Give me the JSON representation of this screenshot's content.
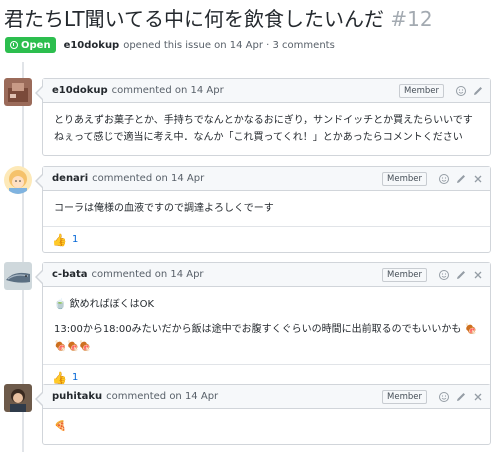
{
  "issue": {
    "title": "君たちLT聞いてる中に何を飲食したいんだ",
    "number": "#12",
    "state": "Open",
    "author": "e10dokup",
    "meta_text": "opened this issue on 14 Apr · 3 comments"
  },
  "comments": [
    {
      "author": "e10dokup",
      "action": "commented on 14 Apr",
      "badge": "Member",
      "body": [
        "とりあえずお菓子とか、手持ちでなんとかなるおにぎり，サンドイッチとか買えたらいいですねぇって感じで適当に考え中．なんか「これ買ってくれ！」とかあったらコメントください"
      ]
    },
    {
      "author": "denari",
      "action": "commented on 14 Apr",
      "badge": "Member",
      "body": [
        "コーラは俺様の血液ですので調達よろしくでーす"
      ],
      "reaction_icon": "👍",
      "reaction_count": "1"
    },
    {
      "author": "c-bata",
      "action": "commented on 14 Apr",
      "badge": "Member",
      "body": [
        "🍵 飲めればぼくはOK",
        "13:00から18:00みたいだから飯は途中でお腹すくぐらいの時間に出前取るのでもいいかも 🍖🍖🍖🍖"
      ],
      "reaction_icon": "👍",
      "reaction_count": "1"
    },
    {
      "author": "puhitaku",
      "action": "commented on 14 Apr",
      "badge": "Member",
      "body": [
        "🍕"
      ]
    }
  ],
  "colors": {
    "open_green": "#2cbe4e",
    "border": "#d1d5da",
    "header_bg": "#f6f8fa",
    "link_blue": "#0366d6"
  },
  "icons": {
    "open": "issue-opened-icon",
    "add_reaction": "smiley-icon",
    "edit": "pencil-icon",
    "delete": "close-icon",
    "reaction": "thumbs-up-icon"
  }
}
